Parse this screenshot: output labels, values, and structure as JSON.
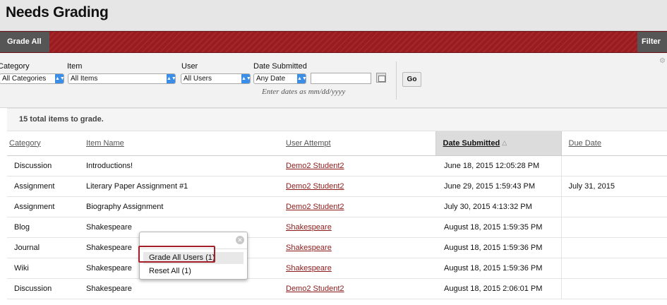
{
  "header": {
    "title": "Needs Grading"
  },
  "action_bar": {
    "grade_all": "Grade All",
    "filter": "Filter"
  },
  "filters": {
    "category": {
      "label": "Category",
      "value": "All Categories"
    },
    "item": {
      "label": "Item",
      "value": "All Items"
    },
    "user": {
      "label": "User",
      "value": "All Users"
    },
    "date_submitted": {
      "label": "Date Submitted",
      "value": "Any Date",
      "input_value": "",
      "hint": "Enter dates as mm/dd/yyyy"
    },
    "go": "Go"
  },
  "summary": {
    "count_text": "15 total items to grade."
  },
  "table": {
    "headers": {
      "category": "Category",
      "item_name": "Item Name",
      "user_attempt": "User Attempt",
      "date_submitted": "Date Submitted",
      "due_date": "Due Date"
    },
    "sorted_column": "date_submitted",
    "rows": [
      {
        "category": "Discussion",
        "item": "Introductions!",
        "user": "Demo2 Student2",
        "submitted": "June 18, 2015 12:05:28 PM",
        "due": ""
      },
      {
        "category": "Assignment",
        "item": "Literary Paper Assignment #1",
        "user": "Demo2 Student2",
        "submitted": "June 29, 2015 1:59:43 PM",
        "due": "July 31, 2015"
      },
      {
        "category": "Assignment",
        "item": "Biography Assignment",
        "user": "Demo2 Student2",
        "submitted": "July 30, 2015 4:13:32 PM",
        "due": ""
      },
      {
        "category": "Blog",
        "item": "Shakespeare",
        "user": "Shakespeare",
        "submitted": "August 18, 2015 1:59:35 PM",
        "due": ""
      },
      {
        "category": "Journal",
        "item": "Shakespeare",
        "user": "Shakespeare",
        "submitted": "August 18, 2015 1:59:36 PM",
        "due": ""
      },
      {
        "category": "Wiki",
        "item": "Shakespeare",
        "user": "Shakespeare",
        "submitted": "August 18, 2015 1:59:36 PM",
        "due": ""
      },
      {
        "category": "Discussion",
        "item": "Shakespeare",
        "user": "Demo2 Student2",
        "submitted": "August 18, 2015 2:06:01 PM",
        "due": ""
      }
    ]
  },
  "context_menu": {
    "items": [
      "Grade All Users (1)",
      "Reset All (1)"
    ],
    "highlighted": "Grade All Users (1)"
  },
  "colors": {
    "action_bar": "#9b1c1f",
    "link": "#8b1a1a",
    "highlight_border": "#a31f2a"
  }
}
